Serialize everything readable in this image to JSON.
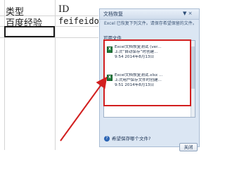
{
  "sheet": {
    "header_a": "类型",
    "header_b": "ID",
    "cell_a2": "百度经验",
    "cell_b2": "feifeidown"
  },
  "pane": {
    "title": "文档恢复",
    "controls": "▼ ×",
    "message": "Excel 已恢复下列文件。请保存希望保留的文件。",
    "available_label": "可用文件",
    "files": [
      {
        "name": "Excel文档恢复测试 (ver...",
        "detail": "上次“自动保存”时创建...",
        "time": "9:54 2014年8月13日"
      },
      {
        "name": "Excel文档恢复测试.xlsx ...",
        "detail": "上次用户保存文件时创建...",
        "time": "9:51 2014年8月13日"
      }
    ],
    "help_text": "希望保存哪个文件?",
    "close_label": "关闭"
  },
  "annotation": {
    "accent_color": "#d21f1f"
  }
}
